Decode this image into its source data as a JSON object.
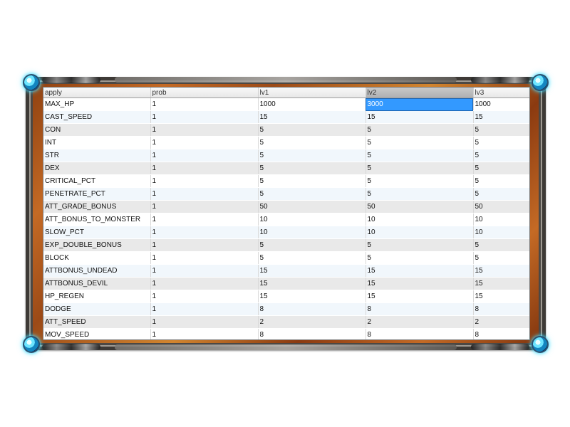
{
  "grid": {
    "columns": [
      {
        "label": "apply"
      },
      {
        "label": "prob"
      },
      {
        "label": "lv1"
      },
      {
        "label": "lv2"
      },
      {
        "label": "lv3"
      }
    ],
    "rows": [
      {
        "cells": [
          "MAX_HP",
          "1",
          "1000",
          "3000",
          "1000"
        ]
      },
      {
        "cells": [
          "CAST_SPEED",
          "1",
          "15",
          "15",
          "15"
        ]
      },
      {
        "cells": [
          "CON",
          "1",
          "5",
          "5",
          "5"
        ]
      },
      {
        "cells": [
          "INT",
          "1",
          "5",
          "5",
          "5"
        ]
      },
      {
        "cells": [
          "STR",
          "1",
          "5",
          "5",
          "5"
        ]
      },
      {
        "cells": [
          "DEX",
          "1",
          "5",
          "5",
          "5"
        ]
      },
      {
        "cells": [
          "CRITICAL_PCT",
          "1",
          "5",
          "5",
          "5"
        ]
      },
      {
        "cells": [
          "PENETRATE_PCT",
          "1",
          "5",
          "5",
          "5"
        ]
      },
      {
        "cells": [
          "ATT_GRADE_BONUS",
          "1",
          "50",
          "50",
          "50"
        ]
      },
      {
        "cells": [
          "ATT_BONUS_TO_MONSTER",
          "1",
          "10",
          "10",
          "10"
        ]
      },
      {
        "cells": [
          "SLOW_PCT",
          "1",
          "10",
          "10",
          "10"
        ]
      },
      {
        "cells": [
          "EXP_DOUBLE_BONUS",
          "1",
          "5",
          "5",
          "5"
        ]
      },
      {
        "cells": [
          "BLOCK",
          "1",
          "5",
          "5",
          "5"
        ]
      },
      {
        "cells": [
          "ATTBONUS_UNDEAD",
          "1",
          "15",
          "15",
          "15"
        ]
      },
      {
        "cells": [
          "ATTBONUS_DEVIL",
          "1",
          "15",
          "15",
          "15"
        ]
      },
      {
        "cells": [
          "HP_REGEN",
          "1",
          "15",
          "15",
          "15"
        ]
      },
      {
        "cells": [
          "DODGE",
          "1",
          "8",
          "8",
          "8"
        ]
      },
      {
        "cells": [
          "ATT_SPEED",
          "1",
          "2",
          "2",
          "2"
        ]
      },
      {
        "cells": [
          "MOV_SPEED",
          "1",
          "8",
          "8",
          "8"
        ]
      }
    ],
    "selection": {
      "row": 1,
      "column": "lv2"
    }
  },
  "theme": {
    "frame_wood": "#b45f22",
    "frame_metal": "#4c4844",
    "gem_color": "#45d9ff",
    "selection_color": "#3399ff"
  },
  "icons": {
    "corner_gems": [
      "corner-gem-icon",
      "corner-gem-icon",
      "corner-gem-icon",
      "corner-gem-icon"
    ]
  }
}
